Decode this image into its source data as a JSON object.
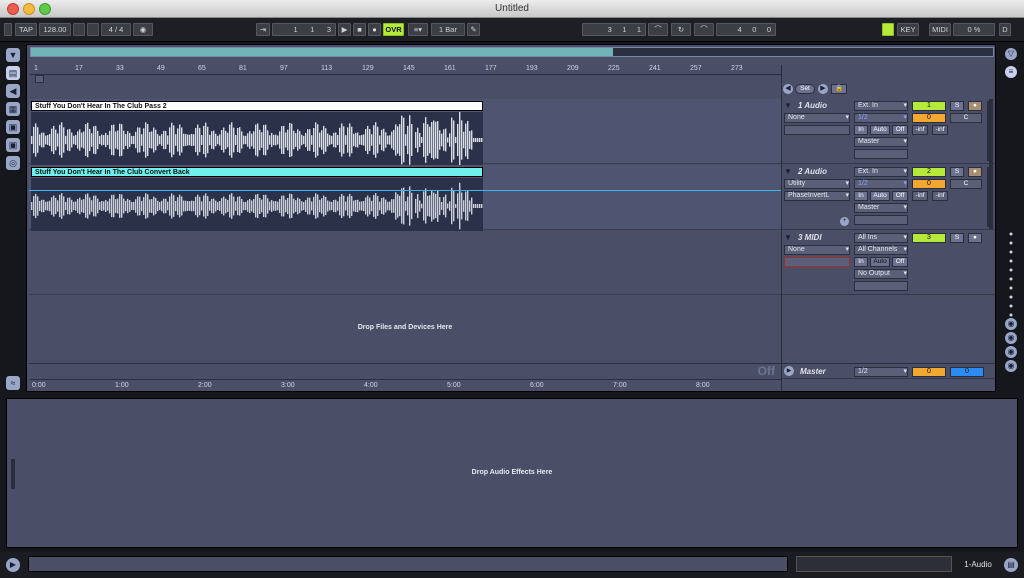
{
  "window": {
    "title": "Untitled"
  },
  "control_bar": {
    "tap": "TAP",
    "tempo": "128.00",
    "sig": "4 / 4",
    "position": [
      "1",
      "1",
      "3"
    ],
    "ovr": "OVR",
    "quant": "1 Bar",
    "loop_start": [
      "3",
      "1",
      "1"
    ],
    "loop_len": [
      "4",
      "0",
      "0"
    ],
    "key": "KEY",
    "midi": "MIDI",
    "cpu": "0 %",
    "disk": "D"
  },
  "ruler": {
    "bars": [
      "1",
      "17",
      "33",
      "49",
      "65",
      "81",
      "97",
      "113",
      "129",
      "145",
      "161",
      "177",
      "193",
      "209",
      "225",
      "241",
      "257",
      "273"
    ],
    "times": [
      "0:00",
      "1:00",
      "2:00",
      "3:00",
      "4:00",
      "5:00",
      "6:00",
      "7:00",
      "8:00"
    ]
  },
  "tracks": [
    {
      "clip": "Stuff You Don't Hear In The Club Pass 2",
      "name": "1 Audio",
      "input": "Ext. In",
      "channel": "1/2",
      "device": "None",
      "in": "In",
      "auto": "Auto",
      "off": "Off",
      "output": "Master",
      "number": "1",
      "solo": "S",
      "vol": "0",
      "pan": "C",
      "inf1": "-inf",
      "inf2": "-inf"
    },
    {
      "clip": "Stuff You Don't Hear In The Club Convert Back",
      "name": "2 Audio",
      "input": "Ext. In",
      "channel": "1/2",
      "device": "Utility",
      "device2": "PhaseInvertL",
      "in": "In",
      "auto": "Auto",
      "off": "Off",
      "output": "Master",
      "number": "2",
      "solo": "S",
      "vol": "0",
      "pan": "C",
      "inf1": "-inf",
      "inf2": "-inf"
    },
    {
      "name": "3 MIDI",
      "input": "All Ins",
      "channel": "All Channels",
      "device": "None",
      "in": "In",
      "auto": "Auto",
      "off": "Off",
      "output": "No Output",
      "number": "3",
      "solo": "S"
    }
  ],
  "drop_files": "Drop Files and Devices Here",
  "master": {
    "off": "Off",
    "name": "Master",
    "channel": "1/2",
    "vol": "0",
    "vol2": "0"
  },
  "set_label": "Set",
  "detail": {
    "drop": "Drop Audio Effects Here"
  },
  "status": {
    "track": "1-Audio"
  }
}
